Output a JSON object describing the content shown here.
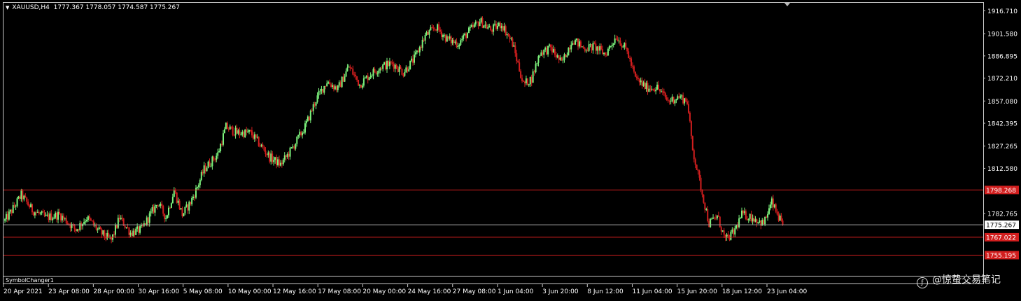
{
  "window": {
    "title_symbol": "XAUUSD,H4",
    "ohlc": "1777.367 1778.057 1774.587 1775.267",
    "indicator_panel": "SymbolChanger1",
    "watermark": "@惊蛰交易笔记"
  },
  "colors": {
    "background": "#000000",
    "bull": "#7cf27c",
    "bear": "#d21e1e",
    "hline": "#d21e1e",
    "bid_line": "#a0a0a0",
    "text": "#ffffff"
  },
  "chart_data": {
    "type": "candlestick",
    "title": "XAUUSD,H4",
    "price_range": [
      1742,
      1922
    ],
    "y_ticks": [
      "1916.710",
      "1901.580",
      "1886.895",
      "1872.210",
      "1857.080",
      "1842.395",
      "1827.265",
      "1812.580",
      "1782.765"
    ],
    "x_ticks": [
      "20 Apr 2021",
      "23 Apr 08:00",
      "28 Apr 00:00",
      "30 Apr 16:00",
      "5 May 08:00",
      "10 May 00:00",
      "12 May 16:00",
      "17 May 08:00",
      "20 May 00:00",
      "24 May 16:00",
      "27 May 08:00",
      "1 Jun 04:00",
      "3 Jun 20:00",
      "8 Jun 12:00",
      "11 Jun 04:00",
      "15 Jun 20:00",
      "18 Jun 12:00",
      "23 Jun 04:00"
    ],
    "horizontal_lines": [
      {
        "price": 1798.268,
        "label": "1798.268",
        "color": "red"
      },
      {
        "price": 1767.022,
        "label": "1767.022",
        "color": "red"
      },
      {
        "price": 1755.195,
        "label": "1755.195",
        "color": "red"
      }
    ],
    "current_price": {
      "price": 1775.267,
      "label": "1775.267"
    },
    "path_anchors": [
      [
        0,
        1778
      ],
      [
        6,
        1786
      ],
      [
        12,
        1795
      ],
      [
        20,
        1785
      ],
      [
        30,
        1780
      ],
      [
        40,
        1782
      ],
      [
        52,
        1772
      ],
      [
        60,
        1780
      ],
      [
        70,
        1770
      ],
      [
        78,
        1765
      ],
      [
        84,
        1780
      ],
      [
        92,
        1770
      ],
      [
        100,
        1772
      ],
      [
        112,
        1790
      ],
      [
        118,
        1780
      ],
      [
        124,
        1798
      ],
      [
        130,
        1782
      ],
      [
        136,
        1790
      ],
      [
        140,
        1798
      ],
      [
        146,
        1812
      ],
      [
        156,
        1822
      ],
      [
        162,
        1840
      ],
      [
        170,
        1836
      ],
      [
        180,
        1836
      ],
      [
        188,
        1827
      ],
      [
        194,
        1820
      ],
      [
        202,
        1815
      ],
      [
        210,
        1825
      ],
      [
        220,
        1840
      ],
      [
        228,
        1858
      ],
      [
        236,
        1870
      ],
      [
        244,
        1865
      ],
      [
        252,
        1880
      ],
      [
        260,
        1868
      ],
      [
        268,
        1875
      ],
      [
        276,
        1880
      ],
      [
        284,
        1882
      ],
      [
        292,
        1876
      ],
      [
        300,
        1885
      ],
      [
        308,
        1900
      ],
      [
        316,
        1906
      ],
      [
        324,
        1898
      ],
      [
        332,
        1895
      ],
      [
        340,
        1903
      ],
      [
        348,
        1910
      ],
      [
        356,
        1904
      ],
      [
        364,
        1908
      ],
      [
        372,
        1895
      ],
      [
        380,
        1868
      ],
      [
        386,
        1872
      ],
      [
        392,
        1889
      ],
      [
        400,
        1892
      ],
      [
        408,
        1882
      ],
      [
        416,
        1898
      ],
      [
        424,
        1892
      ],
      [
        432,
        1893
      ],
      [
        440,
        1888
      ],
      [
        448,
        1900
      ],
      [
        456,
        1890
      ],
      [
        462,
        1872
      ],
      [
        470,
        1866
      ],
      [
        478,
        1866
      ],
      [
        486,
        1857
      ],
      [
        494,
        1860
      ],
      [
        500,
        1857
      ],
      [
        504,
        1825
      ],
      [
        510,
        1800
      ],
      [
        516,
        1776
      ],
      [
        522,
        1781
      ],
      [
        528,
        1765
      ],
      [
        534,
        1770
      ],
      [
        540,
        1782
      ],
      [
        548,
        1780
      ],
      [
        556,
        1776
      ],
      [
        562,
        1790
      ],
      [
        566,
        1782
      ],
      [
        570,
        1775
      ]
    ],
    "num_bars": 571
  }
}
